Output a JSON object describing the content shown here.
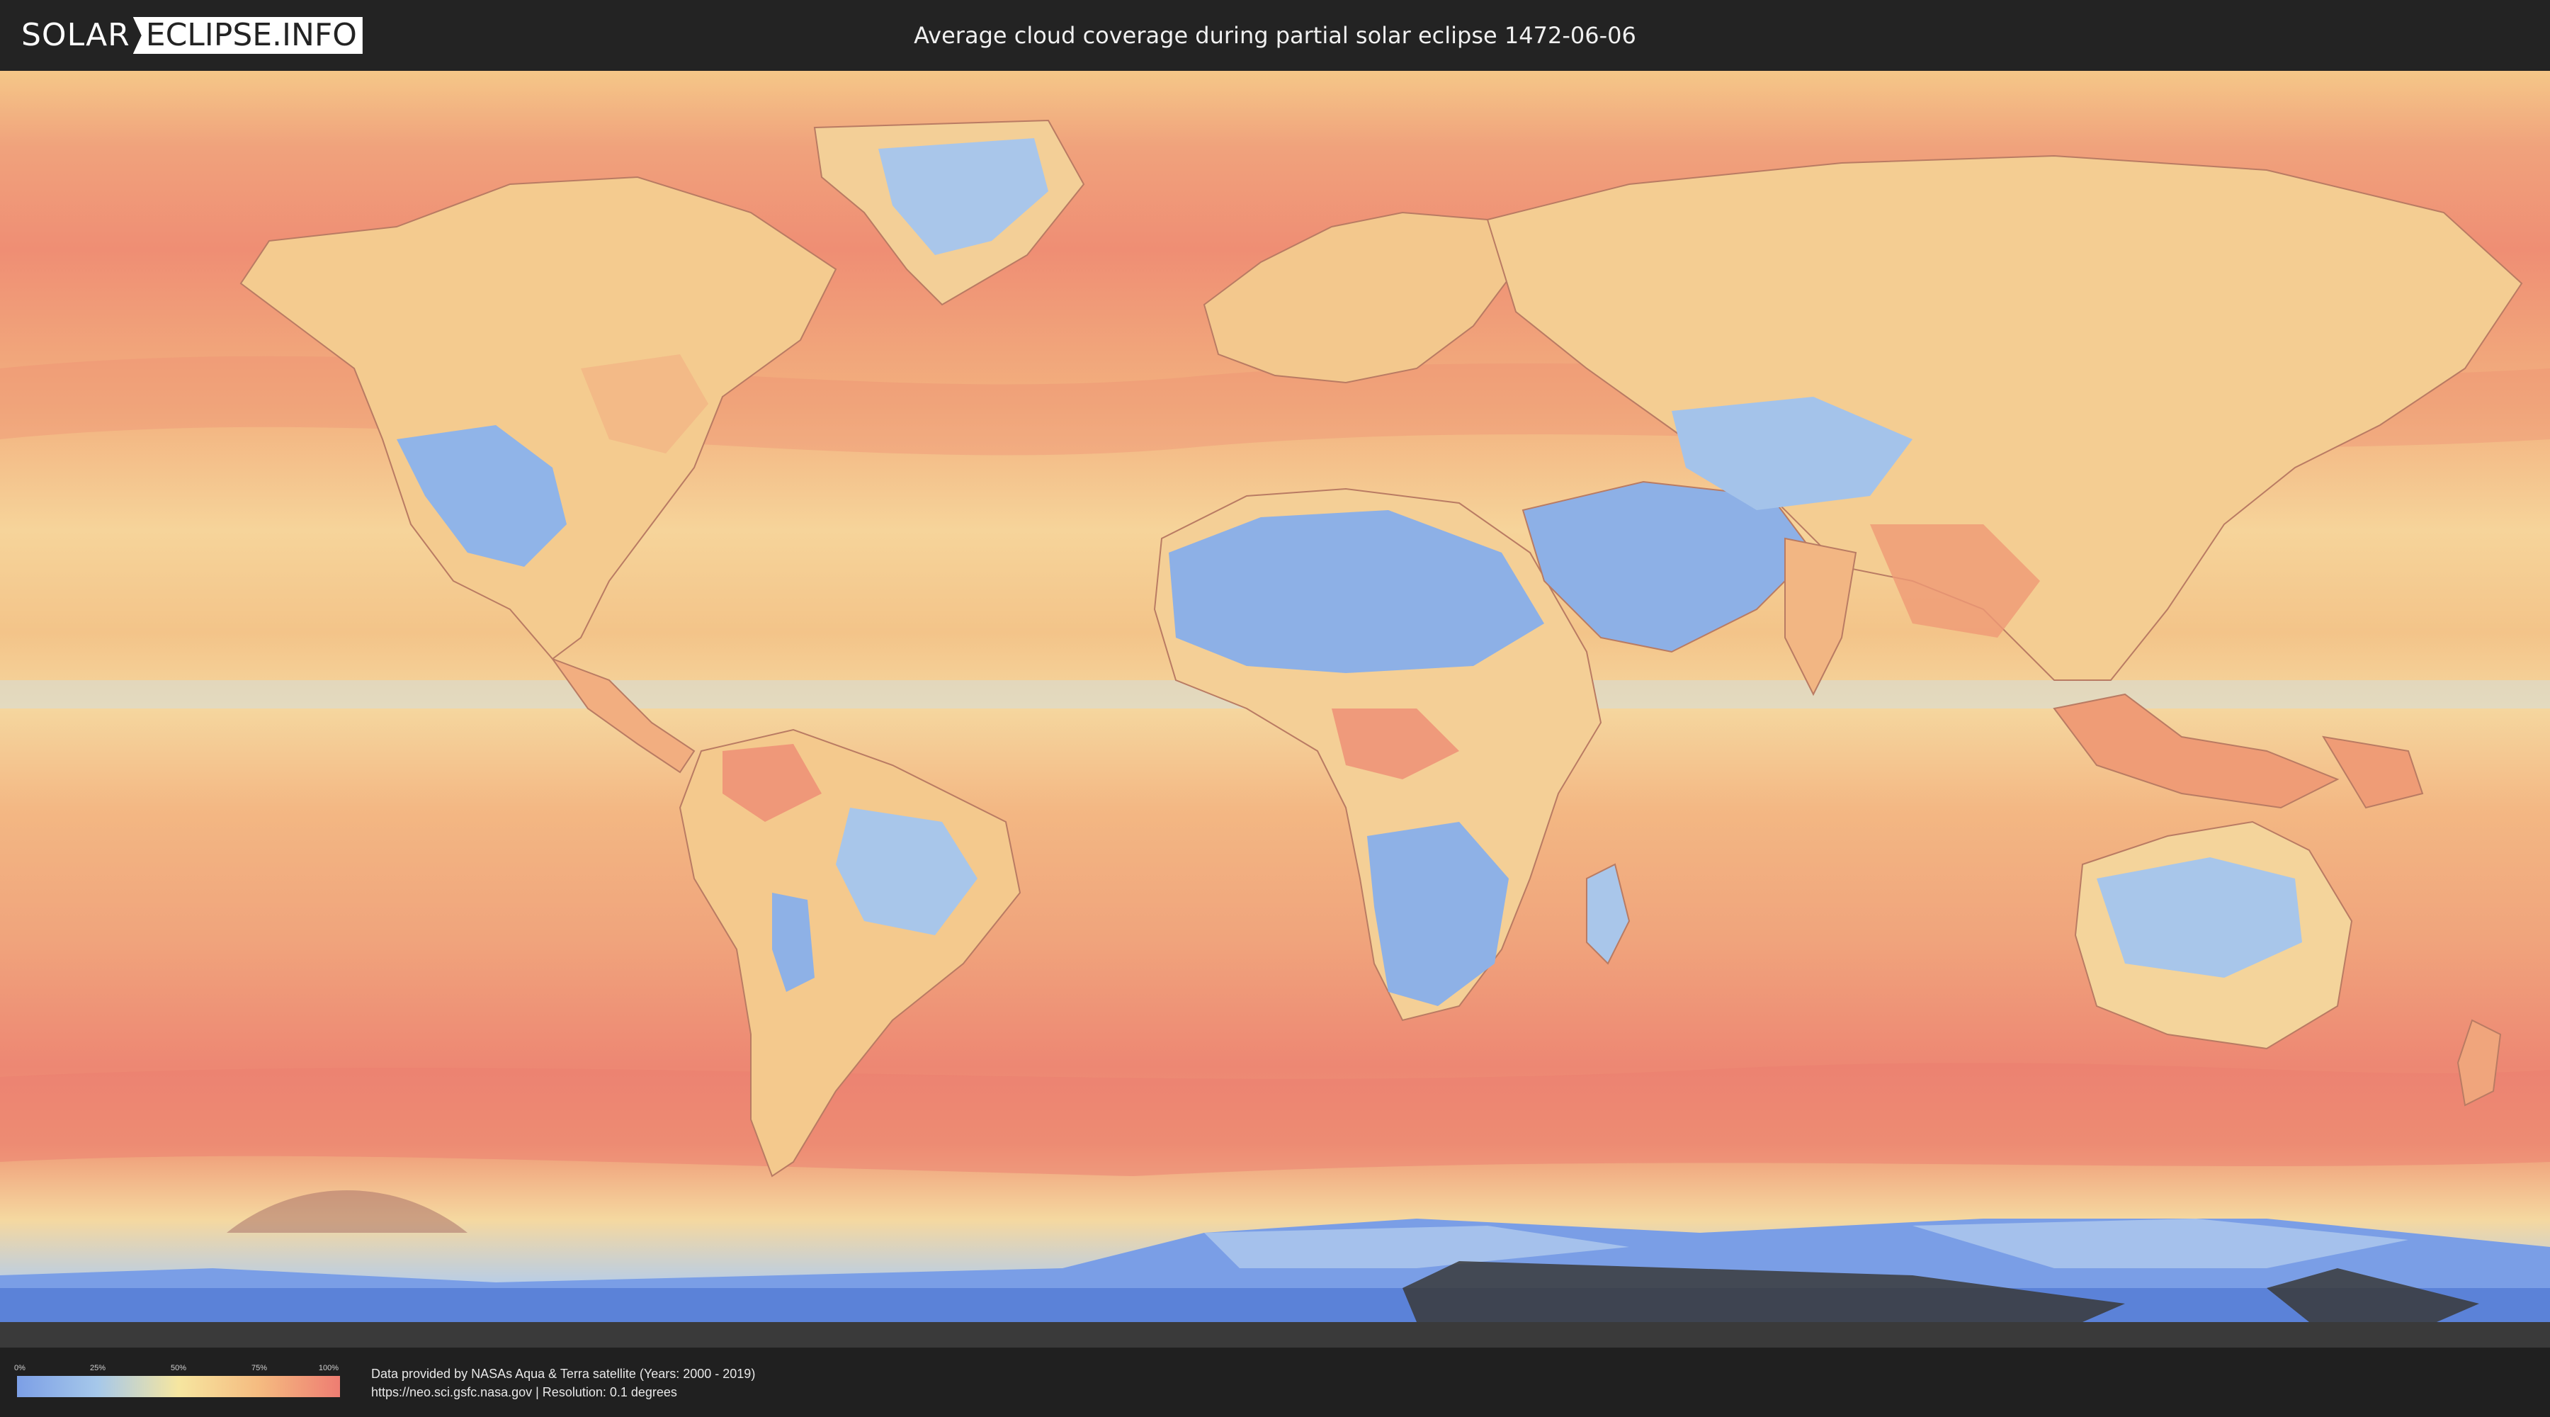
{
  "header": {
    "logo_part1": "SOLAR",
    "logo_part2": "ECLIPSE.INFO",
    "title": "Average cloud coverage during partial solar eclipse 1472-06-06"
  },
  "map": {
    "colors": {
      "ocean_cloudy": "#ee8a72",
      "mid_cloud": "#f4c684",
      "low_cloud": "#f5e2a6",
      "clear": "#8eb1e6",
      "antarctica": "#5f86d9",
      "shadow": "#3a3a3a",
      "border": "#b97b63"
    }
  },
  "legend": {
    "ticks": [
      "0%",
      "25%",
      "50%",
      "75%",
      "100%"
    ],
    "gradient": [
      "#7c9fe6",
      "#a6c8ea",
      "#f6e6a0",
      "#f5bb80",
      "#ee7d72"
    ]
  },
  "credits": {
    "line1": "Data provided by NASAs Aqua & Terra satellite (Years: 2000 - 2019)",
    "line2": "https://neo.sci.gsfc.nasa.gov | Resolution: 0.1 degrees"
  }
}
